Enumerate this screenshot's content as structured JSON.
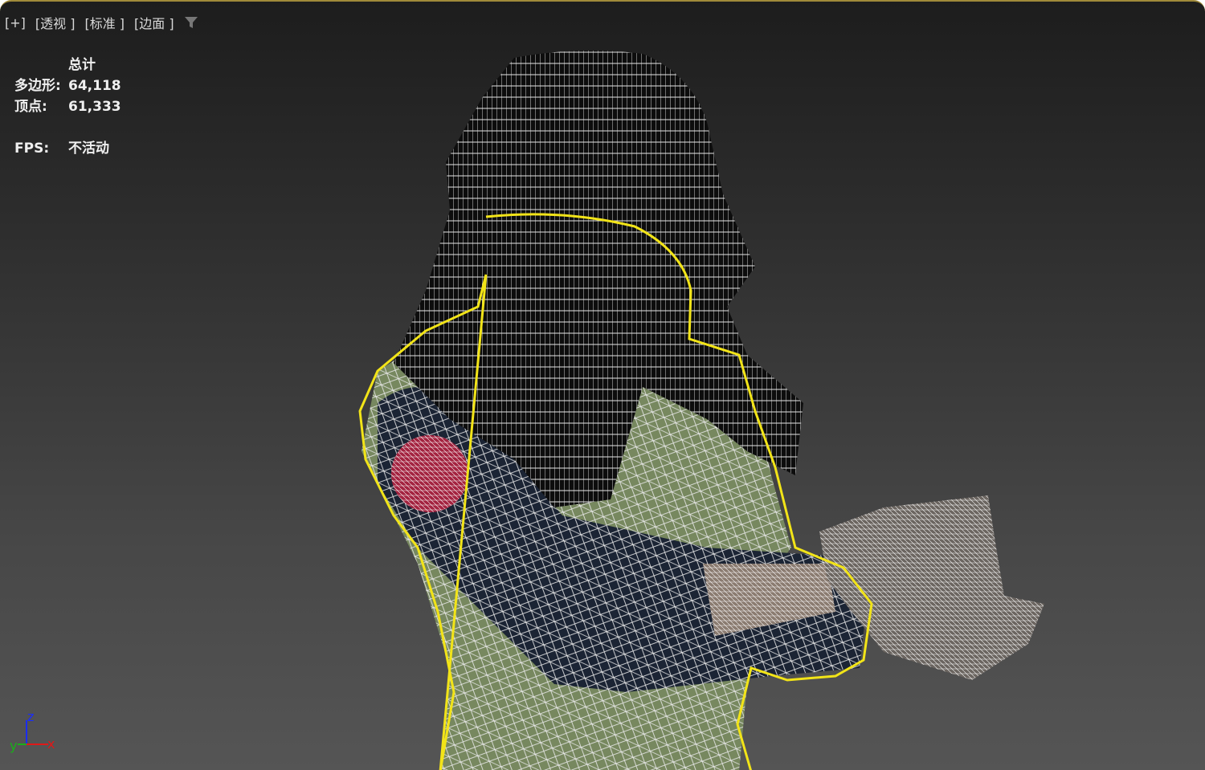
{
  "viewport": {
    "labels": {
      "plus": "[+]",
      "view": "[透视 ]",
      "shading": "[标准 ]",
      "display": "[边面 ]"
    },
    "stats": {
      "header": "总计",
      "polygons_label": "多边形:",
      "polygons_value": "64,118",
      "vertices_label": "顶点:",
      "vertices_value": "61,333",
      "fps_label": "FPS:",
      "fps_value": "不活动"
    },
    "gizmo": {
      "z": "z",
      "y": "y",
      "x": "x"
    },
    "colors": {
      "selection": "#f2e418",
      "vest": "#7b8d6a",
      "sleeve": "#1c2535",
      "patch": "#a3223f",
      "wire": "#e8e8e8"
    }
  }
}
